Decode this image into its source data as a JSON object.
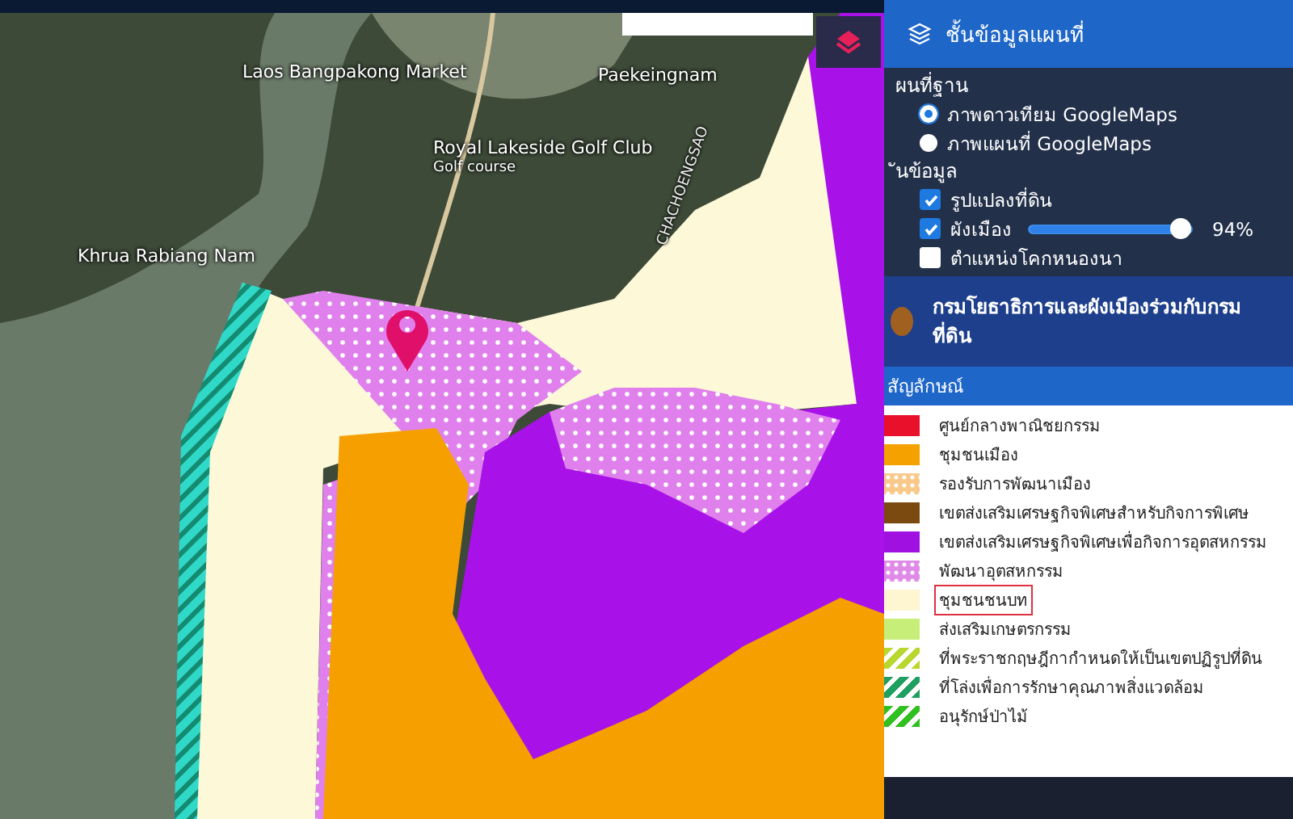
{
  "map": {
    "labels": [
      {
        "text": "Laos Bangpakong Market",
        "kind": "place"
      },
      {
        "text": "Paekeingnam",
        "kind": "place"
      },
      {
        "text": "Royal Lakeside Golf Club",
        "kind": "place"
      },
      {
        "text": "Golf course",
        "kind": "sub"
      },
      {
        "text": "Khrua Rabiang Nam",
        "kind": "place"
      },
      {
        "text": "CHACHOENGSAO",
        "kind": "road"
      }
    ]
  },
  "panel": {
    "title": "ชั้นข้อมูลแผนที่",
    "basemap": {
      "heading": "ผนที่ฐาน",
      "options": [
        {
          "label": "ภาพดาวเทียม GoogleMaps",
          "selected": true
        },
        {
          "label": "ภาพแผนที่ GoogleMaps",
          "selected": false
        }
      ]
    },
    "layers": {
      "heading": "ันข้อมูล",
      "items": [
        {
          "label": "รูปแปลงที่ดิน",
          "checked": true,
          "kind": "plain"
        },
        {
          "label": "ผังเมือง",
          "checked": true,
          "kind": "slider",
          "level": 0.94,
          "reading": "94%"
        },
        {
          "label": "ตำแหน่งโคกหนองนา",
          "checked": false,
          "kind": "plain"
        }
      ]
    },
    "agency": "กรมโยธาธิการและผังเมืองร่วมกับกรมที่ดิน",
    "legend": {
      "heading": "สัญลักษณ์",
      "items": [
        {
          "label": "ศูนย์กลางพาณิชยกรรม",
          "color": "#e8102a",
          "kind": "solid",
          "selected": false
        },
        {
          "label": "ชุมชนเมือง",
          "color": "#f5a100",
          "kind": "solid",
          "selected": false
        },
        {
          "label": "รองรับการพัฒนาเมือง",
          "color": "#f8c98a",
          "kind": "dotted",
          "selected": false
        },
        {
          "label": "เขตส่งเสริมเศรษฐกิจพิเศษสำหรับกิจการพิเศษ",
          "color": "#7a4a10",
          "kind": "solid",
          "selected": false
        },
        {
          "label": "เขตส่งเสริมเศรษฐกิจพิเศษเพื่อกิจการอุตสหกรรม",
          "color": "#a010e0",
          "kind": "solid",
          "selected": false
        },
        {
          "label": "พัฒนาอุตสหกรรม",
          "color": "#e08ae8",
          "kind": "dotted",
          "selected": false
        },
        {
          "label": "ชุมชนชนบท",
          "color": "#fdf6d0",
          "kind": "solid",
          "selected": true
        },
        {
          "label": "ส่งเสริมเกษตรกรรม",
          "color": "#c8ee7a",
          "kind": "solid",
          "selected": false
        },
        {
          "label": "ที่พระราชกฤษฎีกากำหนดให้เป็นเขตปฏิรูปที่ดิน",
          "color": "#b8d830",
          "kind": "hatched",
          "selected": false
        },
        {
          "label": "ที่โล่งเพื่อการรักษาคุณภาพสิ่งแวดล้อม",
          "color": "#20a060",
          "kind": "hatched",
          "selected": false
        },
        {
          "label": "อนุรักษ์ป่าไม้",
          "color": "#30c020",
          "kind": "hatched",
          "selected": false
        }
      ]
    }
  }
}
